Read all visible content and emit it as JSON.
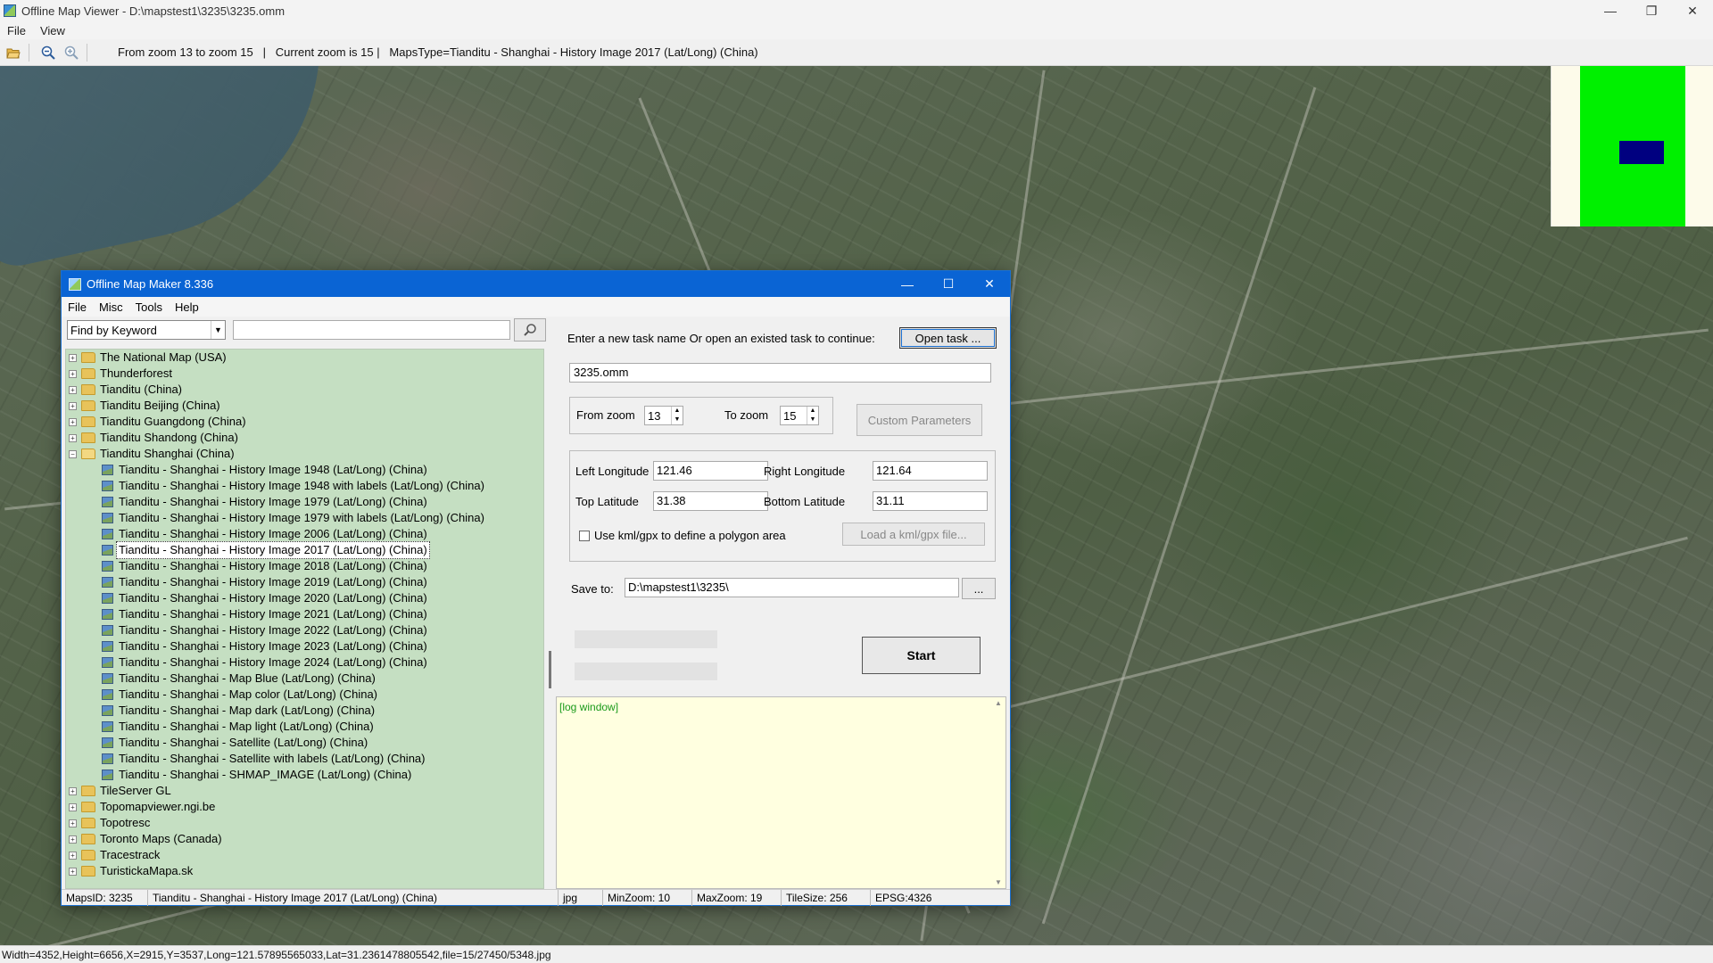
{
  "viewer": {
    "title": "Offline Map Viewer - D:\\mapstest1\\3235\\3235.omm",
    "menu": [
      "File",
      "View"
    ],
    "toolbar_info": "From zoom 13 to zoom 15   |   Current zoom is 15 |   MapsType=Tianditu - Shanghai - History Image 2017 (Lat/Long) (China)",
    "status": "Width=4352,Height=6656,X=2915,Y=3537,Long=121.57895565033,Lat=31.2361478805542,file=15/27450/5348.jpg",
    "controls": {
      "minimize": "—",
      "maximize": "❐",
      "close": "✕"
    },
    "icons": [
      "open-folder-icon",
      "zoom-out-icon",
      "zoom-in-icon"
    ]
  },
  "maker": {
    "title": "Offline Map Maker 8.336",
    "controls": {
      "minimize": "—",
      "maximize": "☐",
      "close": "✕"
    },
    "menu": [
      "File",
      "Misc",
      "Tools",
      "Help"
    ],
    "search": {
      "mode": "Find by Keyword",
      "value": ""
    },
    "tree": [
      {
        "label": "The National Map (USA)",
        "type": "folder"
      },
      {
        "label": "Thunderforest",
        "type": "folder"
      },
      {
        "label": "Tianditu (China)",
        "type": "folder"
      },
      {
        "label": "Tianditu Beijing (China)",
        "type": "folder"
      },
      {
        "label": "Tianditu Guangdong (China)",
        "type": "folder"
      },
      {
        "label": "Tianditu Shandong (China)",
        "type": "folder"
      },
      {
        "label": "Tianditu Shanghai (China)",
        "type": "folder-open"
      },
      {
        "label": "Tianditu - Shanghai - History Image 1948 (Lat/Long) (China)",
        "type": "map"
      },
      {
        "label": "Tianditu - Shanghai - History Image 1948 with labels (Lat/Long) (China)",
        "type": "map"
      },
      {
        "label": "Tianditu - Shanghai - History Image 1979 (Lat/Long) (China)",
        "type": "map"
      },
      {
        "label": "Tianditu - Shanghai - History Image 1979 with labels (Lat/Long) (China)",
        "type": "map"
      },
      {
        "label": "Tianditu - Shanghai - History Image 2006 (Lat/Long) (China)",
        "type": "map"
      },
      {
        "label": "Tianditu - Shanghai - History Image 2017 (Lat/Long) (China)",
        "type": "map",
        "selected": true
      },
      {
        "label": "Tianditu - Shanghai - History Image 2018 (Lat/Long) (China)",
        "type": "map"
      },
      {
        "label": "Tianditu - Shanghai - History Image 2019 (Lat/Long) (China)",
        "type": "map"
      },
      {
        "label": "Tianditu - Shanghai - History Image 2020 (Lat/Long) (China)",
        "type": "map"
      },
      {
        "label": "Tianditu - Shanghai - History Image 2021 (Lat/Long) (China)",
        "type": "map"
      },
      {
        "label": "Tianditu - Shanghai - History Image 2022 (Lat/Long) (China)",
        "type": "map"
      },
      {
        "label": "Tianditu - Shanghai - History Image 2023 (Lat/Long) (China)",
        "type": "map"
      },
      {
        "label": "Tianditu - Shanghai - History Image 2024 (Lat/Long) (China)",
        "type": "map"
      },
      {
        "label": "Tianditu - Shanghai - Map Blue (Lat/Long) (China)",
        "type": "map"
      },
      {
        "label": "Tianditu - Shanghai - Map color (Lat/Long) (China)",
        "type": "map"
      },
      {
        "label": "Tianditu - Shanghai - Map dark (Lat/Long) (China)",
        "type": "map"
      },
      {
        "label": "Tianditu - Shanghai - Map light (Lat/Long) (China)",
        "type": "map"
      },
      {
        "label": "Tianditu - Shanghai - Satellite (Lat/Long) (China)",
        "type": "map"
      },
      {
        "label": "Tianditu - Shanghai - Satellite with labels (Lat/Long) (China)",
        "type": "map"
      },
      {
        "label": "Tianditu - Shanghai - SHMAP_IMAGE (Lat/Long) (China)",
        "type": "map"
      },
      {
        "label": "TileServer GL",
        "type": "folder"
      },
      {
        "label": "Topomapviewer.ngi.be",
        "type": "folder"
      },
      {
        "label": "Topotresc",
        "type": "folder"
      },
      {
        "label": "Toronto Maps (Canada)",
        "type": "folder"
      },
      {
        "label": "Tracestrack",
        "type": "folder"
      },
      {
        "label": "TuristickaMapa.sk",
        "type": "folder"
      }
    ],
    "task": {
      "prompt": "Enter a new task name Or open an existed task to continue:",
      "open_label": "Open task ...",
      "name": "3235.omm"
    },
    "zoom": {
      "from_label": "From zoom",
      "from": "13",
      "to_label": "To zoom",
      "to": "15"
    },
    "custom_params_label": "Custom Parameters",
    "coords": {
      "left_label": "Left Longitude",
      "left": "121.46",
      "right_label": "Right Longitude",
      "right": "121.64",
      "top_label": "Top Latitude",
      "top": "31.38",
      "bottom_label": "Bottom Latitude",
      "bottom": "31.11",
      "kml_checkbox_label": "Use kml/gpx to define a polygon area",
      "kml_checked": false,
      "kml_button": "Load a kml/gpx file..."
    },
    "save": {
      "label": "Save to:",
      "path": "D:\\mapstest1\\3235\\",
      "browse": "..."
    },
    "start_label": "Start",
    "log_text": "[log window]",
    "status": {
      "maps_id": "MapsID: 3235",
      "name": "Tianditu - Shanghai - History Image 2017 (Lat/Long) (China)",
      "format": "jpg",
      "min_zoom": "MinZoom: 10",
      "max_zoom": "MaxZoom: 19",
      "tile_size": "TileSize: 256",
      "epsg": "EPSG:4326"
    }
  },
  "colors": {
    "titlebar_active": "#0a64d4",
    "tree_bg": "#c5dfc2",
    "log_bg": "#ffffe0",
    "log_text": "#1a9a1a",
    "overview_green": "#00f000",
    "overview_box": "#000080"
  }
}
